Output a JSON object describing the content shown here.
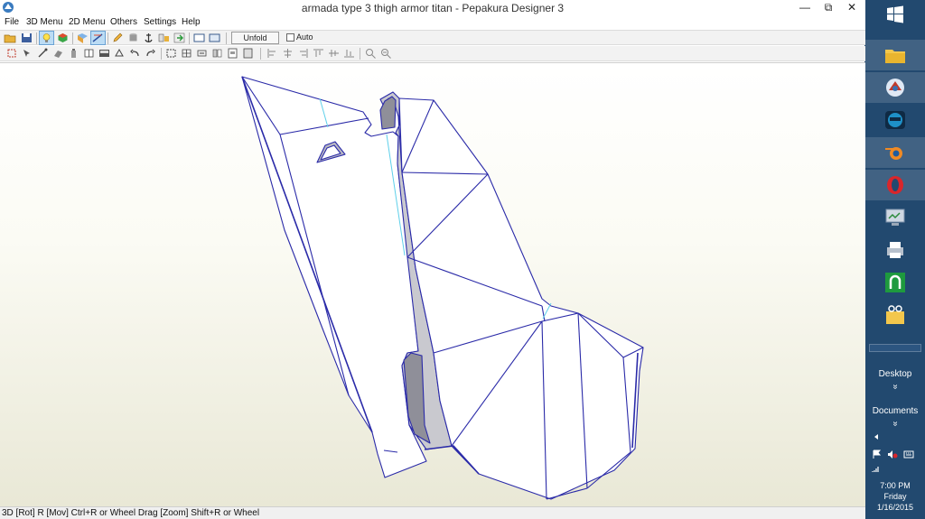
{
  "window": {
    "title": "armada type 3 thigh armor titan - Pepakura Designer 3",
    "controls": {
      "minimize": "—",
      "maximize": "⧉",
      "close": "✕"
    }
  },
  "menu": [
    "File",
    "3D Menu",
    "2D Menu",
    "Others",
    "Settings",
    "Help"
  ],
  "toolbar": {
    "unfold_label": "Unfold",
    "auto_label": "Auto"
  },
  "status": {
    "text": "3D [Rot] R [Mov] Ctrl+R or Wheel Drag [Zoom] Shift+R or Wheel"
  },
  "taskbar": {
    "desktop_label": "Desktop",
    "documents_label": "Documents",
    "chevron": "»",
    "time": "7:00 PM",
    "day": "Friday",
    "date": "1/16/2015"
  },
  "colors": {
    "taskbar": "#22496f",
    "model_edge": "#2a2aa8",
    "model_fold": "#5fd0ea",
    "model_face": "#ffffff",
    "model_shade": "#c9c9cf"
  }
}
